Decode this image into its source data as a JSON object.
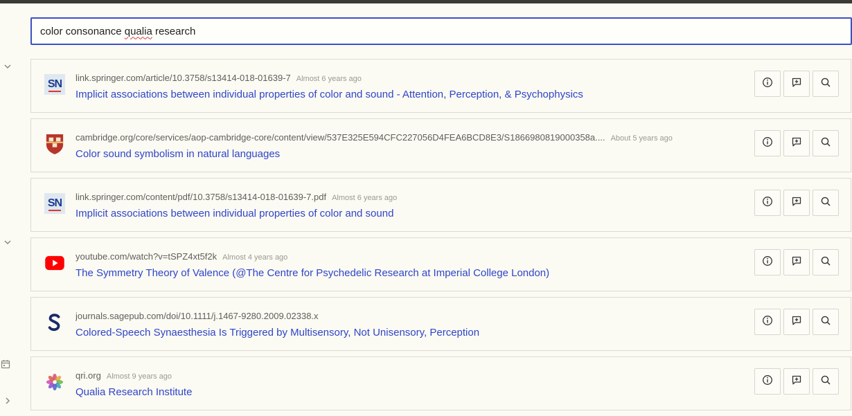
{
  "search": {
    "query_part1": "color consonance ",
    "query_part2": "qualia",
    "query_part3": " research"
  },
  "actions": {
    "info_icon": "info-icon",
    "comment_icon": "comment-plus-icon",
    "search_icon": "search-icon"
  },
  "colors": {
    "accent": "#3c51c2",
    "link": "#2f45c9",
    "background": "#fbfaf3"
  },
  "results": [
    {
      "favicon": "springer-nature-icon",
      "url": "link.springer.com/article/10.3758/s13414-018-01639-7",
      "age": "Almost 6 years ago",
      "title": "Implicit associations between individual properties of color and sound - Attention, Perception, & Psychophysics"
    },
    {
      "favicon": "cambridge-crest-icon",
      "url": "cambridge.org/core/services/aop-cambridge-core/content/view/537E325E594CFC227056D4FEA6BCD8E3/S1866980819000358a....",
      "age": "About 5 years ago",
      "title": "Color sound symbolism in natural languages"
    },
    {
      "favicon": "springer-nature-icon",
      "url": "link.springer.com/content/pdf/10.3758/s13414-018-01639-7.pdf",
      "age": "Almost 6 years ago",
      "title": "Implicit associations between individual properties of color and sound"
    },
    {
      "favicon": "youtube-icon",
      "url": "youtube.com/watch?v=tSPZ4xt5f2k",
      "age": "Almost 4 years ago",
      "title": "The Symmetry Theory of Valence (@The Centre for Psychedelic Research at Imperial College London)"
    },
    {
      "favicon": "sage-icon",
      "url": "journals.sagepub.com/doi/10.1111/j.1467-9280.2009.02338.x",
      "age": "",
      "title": "Colored-Speech Synaesthesia Is Triggered by Multisensory, Not Unisensory, Perception"
    },
    {
      "favicon": "qri-flower-icon",
      "url": "qri.org",
      "age": "Almost 9 years ago",
      "title": "Qualia Research Institute"
    }
  ],
  "rail": {
    "icons": [
      "chevron-down-icon",
      "chevron-down-icon",
      "calendar-icon",
      "chevron-right-icon"
    ]
  }
}
